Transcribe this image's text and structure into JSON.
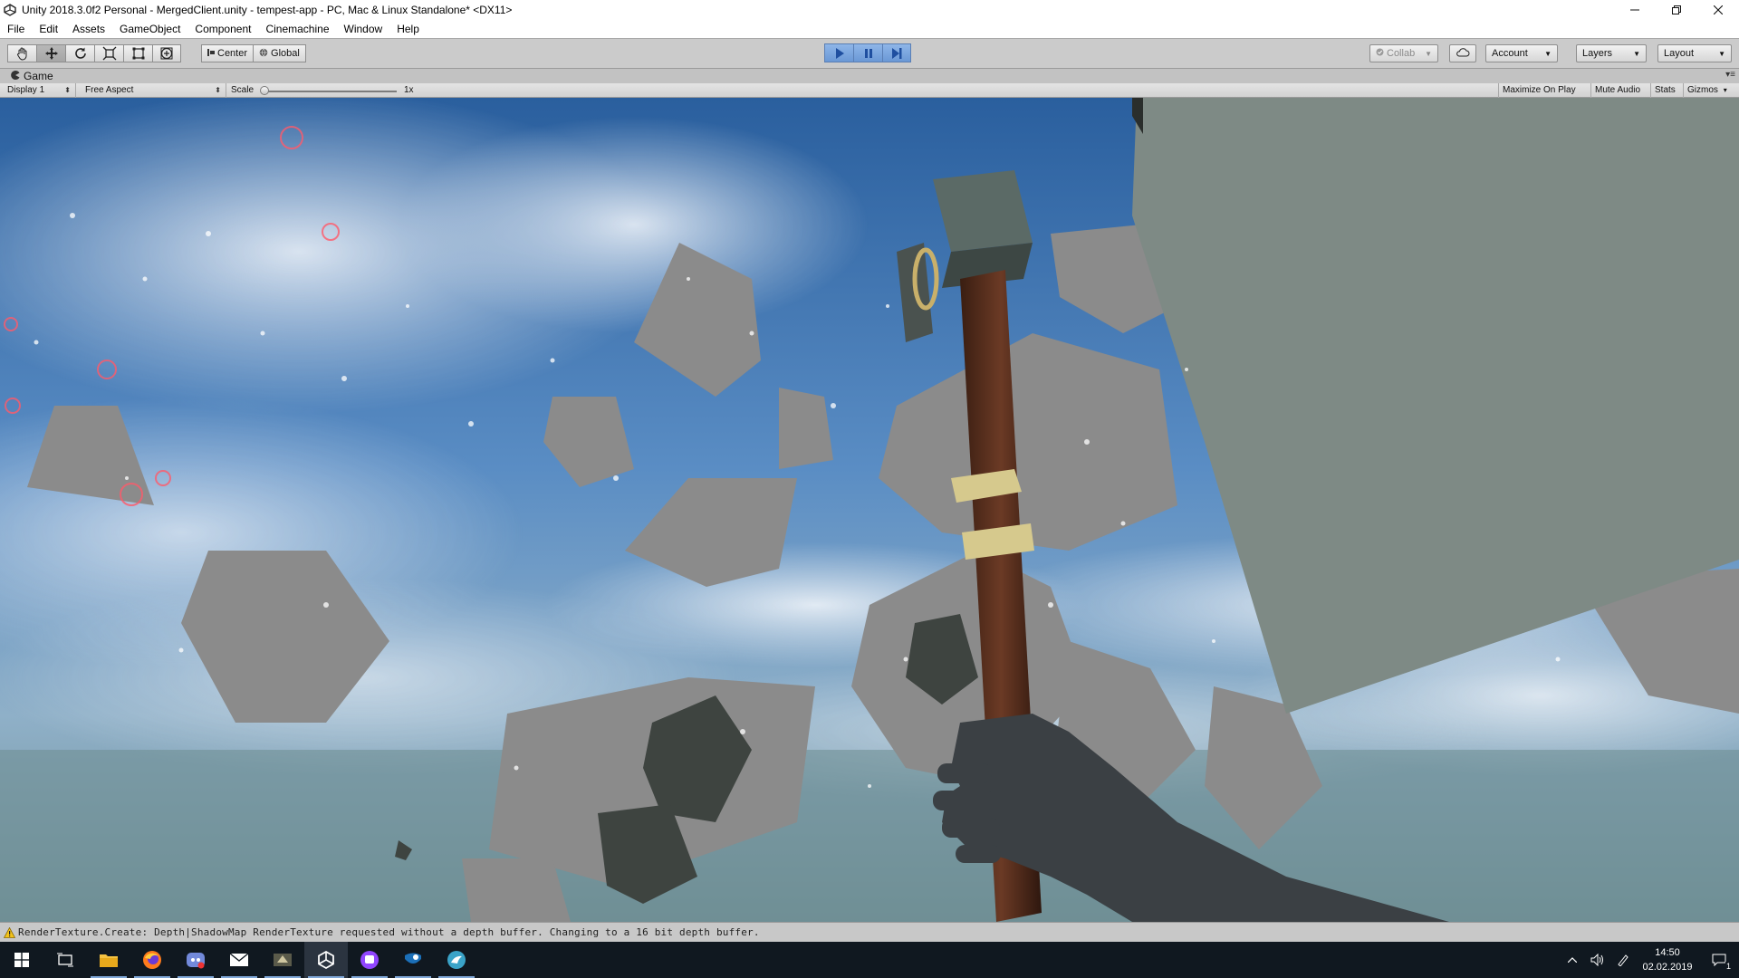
{
  "window": {
    "title": "Unity 2018.3.0f2 Personal - MergedClient.unity - tempest-app - PC, Mac & Linux Standalone* <DX11>",
    "controls": [
      "minimize-icon",
      "restore-icon",
      "close-icon"
    ]
  },
  "menu": [
    "File",
    "Edit",
    "Assets",
    "GameObject",
    "Component",
    "Cinemachine",
    "Window",
    "Help"
  ],
  "toolbar": {
    "tools": [
      "hand-tool-icon",
      "move-tool-icon",
      "rotate-tool-icon",
      "scale-tool-icon",
      "rect-tool-icon",
      "transform-tool-icon"
    ],
    "active_tool": "move-tool-icon",
    "pivot_label": "Center",
    "space_label": "Global",
    "playback": {
      "playing": true,
      "paused": false
    },
    "collab_label": "Collab",
    "account_label": "Account",
    "layers_label": "Layers",
    "layout_label": "Layout"
  },
  "game_view": {
    "tab_label": "Game",
    "display_label": "Display 1",
    "aspect_label": "Free Aspect",
    "scale_label": "Scale",
    "scale_value": "1x",
    "scale_fraction": 0.0,
    "toggles": [
      "Maximize On Play",
      "Mute Audio",
      "Stats",
      "Gizmos"
    ]
  },
  "status": {
    "message": "RenderTexture.Create: Depth|ShadowMap RenderTexture requested without a depth buffer. Changing to a 16 bit depth buffer.",
    "level": "warning"
  },
  "taskbar": {
    "apps": [
      "windows-start-icon",
      "task-view-icon",
      "file-explorer-icon",
      "firefox-icon",
      "discord-icon",
      "mail-icon",
      "game-app-icon",
      "unity-icon",
      "twitch-icon",
      "steam-icon",
      "bird-app-icon"
    ],
    "active_app": "unity-icon",
    "time": "14:50",
    "date": "02.02.2019",
    "notification_count": "1"
  },
  "colors": {
    "play_blue": "#6a98d6",
    "sky_blue": "#2f6fb0",
    "rock_gray": "#8a8a8a",
    "taskbar": "#101820"
  }
}
